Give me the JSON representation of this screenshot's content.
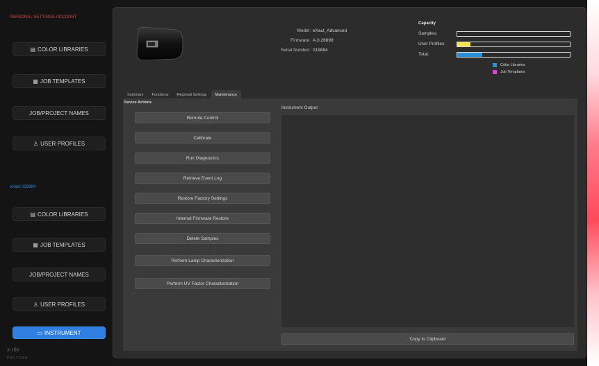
{
  "sidebar": {
    "section1_title": "PERSONAL-SETTINGS-ACCOUNT",
    "section1_items": [
      {
        "label": "COLOR LIBRARIES",
        "icon": "library-icon"
      },
      {
        "label": "JOB TEMPLATES",
        "icon": "template-icon"
      },
      {
        "label": "JOB/PROJECT NAMES",
        "icon": ""
      },
      {
        "label": "USER PROFILES",
        "icon": "user-icon"
      }
    ],
    "section2_title": "eXact 019884",
    "section2_items": [
      {
        "label": "COLOR LIBRARIES",
        "icon": "library-icon"
      },
      {
        "label": "JOB TEMPLATES",
        "icon": "template-icon"
      },
      {
        "label": "JOB/PROJECT NAMES",
        "icon": ""
      },
      {
        "label": "USER PROFILES",
        "icon": "user-icon"
      }
    ],
    "instrument_label": "INSTRUMENT",
    "logo_text": "x-rite",
    "logo_sub": "PANTONE"
  },
  "device_info": {
    "model_label": "Model:",
    "model_value": "eXact_Advanced",
    "firmware_label": "Firmware:",
    "firmware_value": "A.0.26699",
    "serial_label": "Serial Number:",
    "serial_value": "019884"
  },
  "capacity": {
    "title": "Capacity",
    "rows": [
      {
        "label": "Samples:",
        "color_fill": 0.0,
        "job_fill": 0.0
      },
      {
        "label": "User Profiles:",
        "color_fill": 0.0,
        "user_fill": 0.12
      },
      {
        "label": "Total:",
        "color_fill": 0.22,
        "job_fill": 0.0
      }
    ],
    "legend": [
      {
        "label": "Color Libraries",
        "color": "#2a8fd4"
      },
      {
        "label": "Job Templates",
        "color": "#e43ddc"
      }
    ],
    "user_profile_color": "#f4e44a"
  },
  "tabs": [
    "Summary",
    "Functions",
    "Regional Settings",
    "Maintenance"
  ],
  "active_tab": "Maintenance",
  "device_actions_title": "Device Actions",
  "actions": [
    "Remote Control",
    "Calibrate",
    "Run Diagnostics",
    "Retrieve Event Log",
    "Restore Factory Settings",
    "Internal Firmware Restore",
    "Delete Samples",
    "Perform Lamp Characterization",
    "Perform UV Factor Characterization"
  ],
  "output_label": "Instrument Output",
  "copy_label": "Copy to Clipboard"
}
